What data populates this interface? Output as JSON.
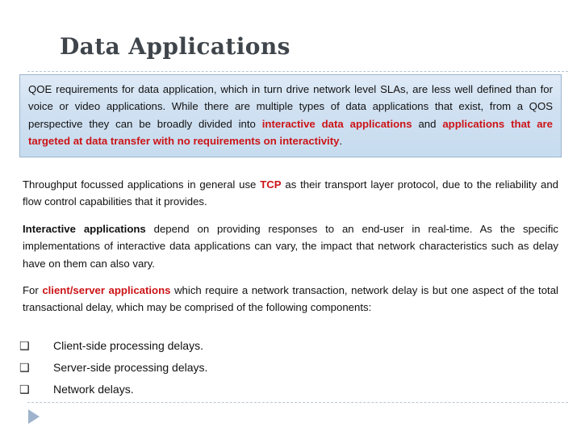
{
  "slide": {
    "title": "Data Applications",
    "callout": {
      "segments": [
        {
          "text": "QOE requirements for data application, which in turn drive network level SLAs, are less well defined than for voice or video applications. While there are multiple types of data applications that exist, from a QOS perspective they can be broadly divided into ",
          "style": "normal"
        },
        {
          "text": "interactive data applications",
          "style": "red-bold"
        },
        {
          "text": " and ",
          "style": "normal"
        },
        {
          "text": "applications that are targeted at data transfer with no requirements on interactivity",
          "style": "red-bold"
        },
        {
          "text": ".",
          "style": "normal"
        }
      ]
    },
    "paragraphs": [
      {
        "segments": [
          {
            "text": "Throughput focussed applications in general use ",
            "style": "normal"
          },
          {
            "text": "TCP",
            "style": "red-bold"
          },
          {
            "text": " as their transport layer protocol, due to the reliability and flow control capabilities that it provides.",
            "style": "normal"
          }
        ]
      },
      {
        "segments": [
          {
            "text": "Interactive applications",
            "style": "bold"
          },
          {
            "text": " depend on providing responses to an end-user in real-time. As the specific implementations of interactive data applications can vary, the impact that network characteristics such as delay have on them can also vary.",
            "style": "normal"
          }
        ]
      },
      {
        "segments": [
          {
            "text": "For ",
            "style": "normal"
          },
          {
            "text": "client/server applications",
            "style": "red-bold"
          },
          {
            "text": " which require a network transaction, network delay is but one aspect of the total transactional delay, which may be comprised of the following components:",
            "style": "normal"
          }
        ]
      }
    ],
    "bullets": {
      "marker": "❑",
      "items": [
        "Client-side processing delays.",
        "Server-side processing delays.",
        "Network delays."
      ]
    },
    "nav": {
      "forward_label": "▶"
    },
    "colors": {
      "accent_red": "#cc1417",
      "callout_fill": "#cfe0f1",
      "callout_border": "#9bb4ce",
      "title": "#3f454b",
      "rule": "#b9c6d4",
      "triangle": "#9fb4cc"
    }
  }
}
